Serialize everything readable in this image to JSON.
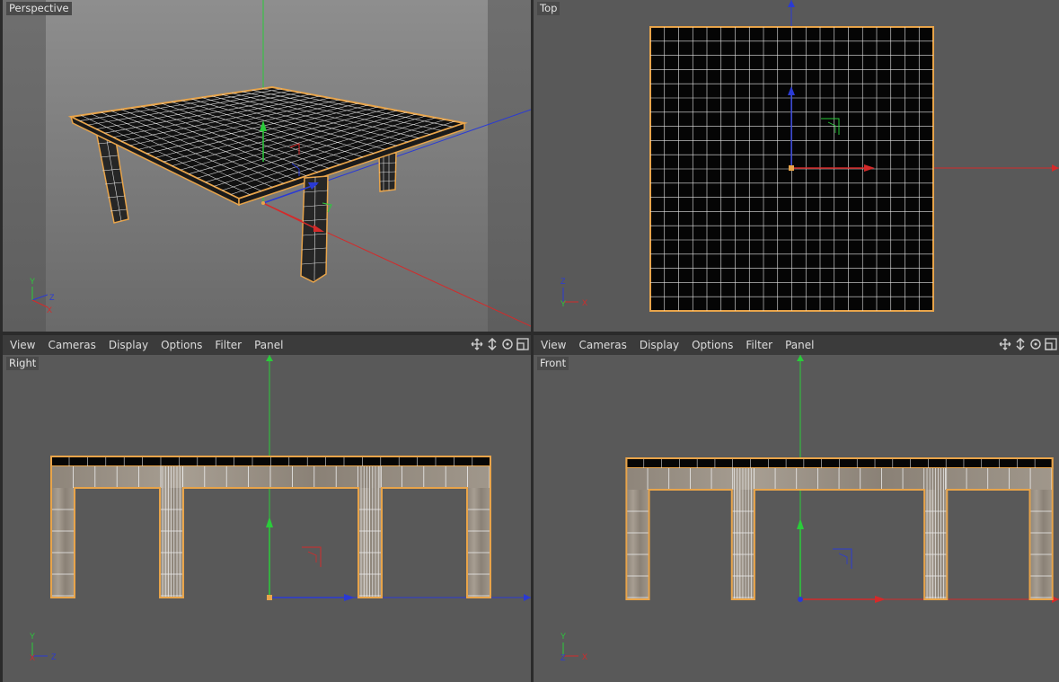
{
  "viewports": {
    "perspective": {
      "label": "Perspective"
    },
    "top": {
      "label": "Top"
    },
    "right": {
      "label": "Right"
    },
    "front": {
      "label": "Front"
    }
  },
  "menu_left": {
    "view": "View",
    "cameras": "Cameras",
    "display": "Display",
    "options": "Options",
    "filter": "Filter",
    "panel": "Panel"
  },
  "menu_right": {
    "view": "View",
    "cameras": "Cameras",
    "display": "Display",
    "options": "Options",
    "filter": "Filter",
    "panel": "Panel"
  },
  "axis": {
    "x": "X",
    "y": "Y",
    "z": "Z"
  },
  "icons": [
    "move-view-icon",
    "dolly-view-icon",
    "rotate-view-icon",
    "maximize-view-icon"
  ],
  "colors": {
    "selection": "#e8a44a",
    "x_axis": "#d42a2a",
    "y_axis": "#2acb3a",
    "z_axis": "#2a3ad4",
    "viewport_bg": "#5a5a5a"
  }
}
